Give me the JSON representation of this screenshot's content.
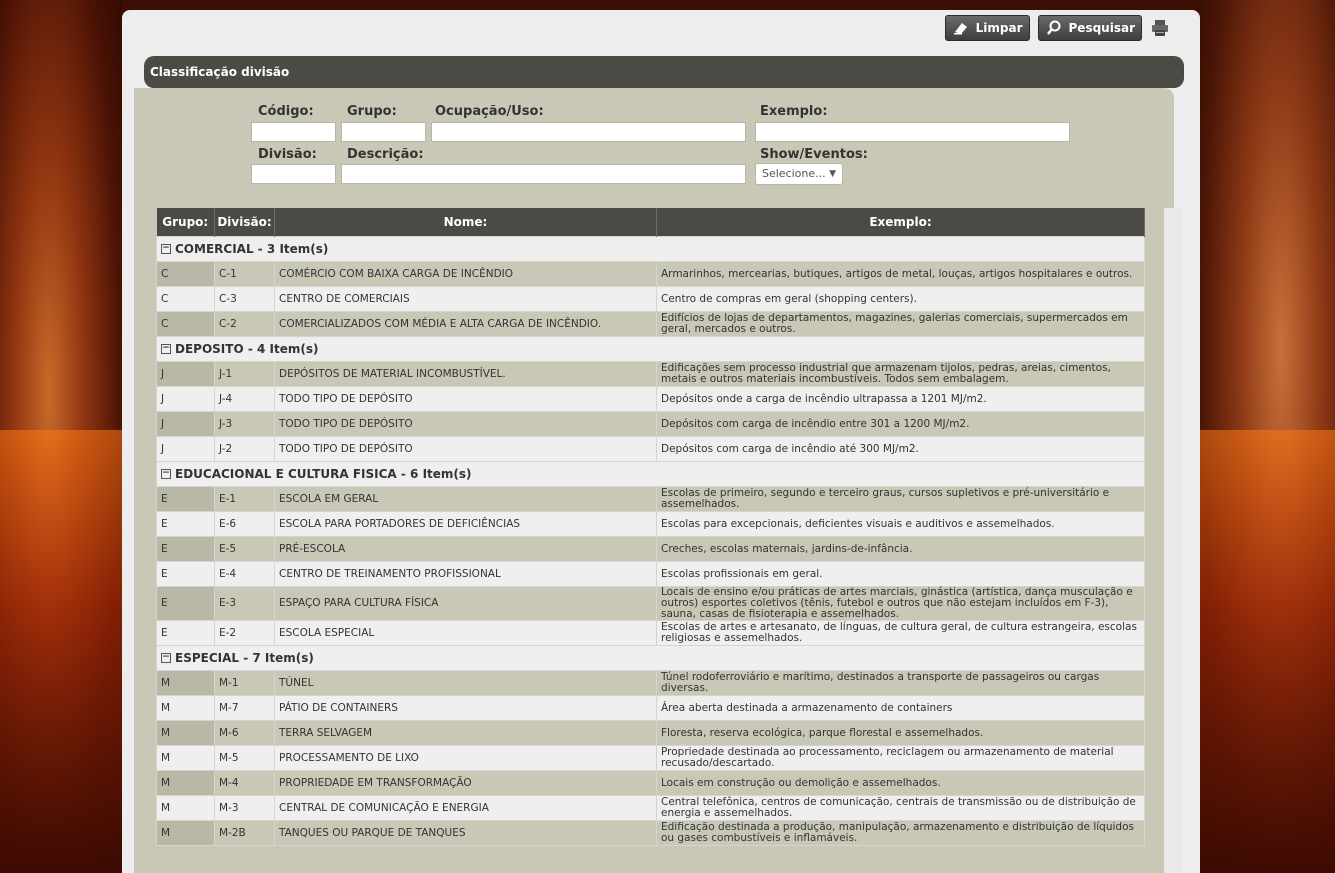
{
  "toolbar": {
    "clear_label": "Limpar",
    "search_label": "Pesquisar"
  },
  "panel": {
    "title": "Classificação divisão"
  },
  "form": {
    "codigo_label": "Código:",
    "grupo_label": "Grupo:",
    "ocupacao_label": "Ocupação/Uso:",
    "exemplo_label": "Exemplo:",
    "divisao_label": "Divisão:",
    "descricao_label": "Descrição:",
    "show_label": "Show/Eventos:",
    "show_value": "Selecione..."
  },
  "table": {
    "headers": [
      "Grupo:",
      "Divisão:",
      "Nome:",
      "Exemplo:"
    ],
    "groups": [
      {
        "title": "COMERCIAL - 3 Item(s)",
        "rows": [
          [
            "C",
            "C-1",
            "COMÉRCIO COM BAIXA CARGA DE INCÊNDIO",
            "Armarinhos, mercearias, butiques, artigos de metal, louças, artigos hospitalares e outros."
          ],
          [
            "C",
            "C-3",
            "CENTRO DE COMERCIAIS",
            "Centro de compras em geral (shopping centers)."
          ],
          [
            "C",
            "C-2",
            "COMERCIALIZADOS COM MÉDIA E ALTA CARGA DE INCÊNDIO.",
            "Edifícios de lojas de departamentos, magazines, galerias comerciais, supermercados em geral, mercados e outros."
          ]
        ]
      },
      {
        "title": "DEPOSITO - 4 Item(s)",
        "rows": [
          [
            "J",
            "J-1",
            "DEPÓSITOS DE MATERIAL INCOMBUSTÍVEL.",
            "Edificações sem processo industrial que armazenam tijolos, pedras, areias, cimentos, metais e outros materiais incombustíveis. Todos sem embalagem."
          ],
          [
            "J",
            "J-4",
            "TODO TIPO DE DEPÓSITO",
            "Depósitos onde a carga de incêndio ultrapassa a 1201 MJ/m2."
          ],
          [
            "J",
            "J-3",
            "TODO TIPO DE DEPÓSITO",
            "Depósitos com carga de incêndio entre 301 a 1200 MJ/m2."
          ],
          [
            "J",
            "J-2",
            "TODO TIPO DE DEPÓSITO",
            "Depósitos com carga de incêndio até 300 MJ/m2."
          ]
        ]
      },
      {
        "title": "EDUCACIONAL E CULTURA FISICA - 6 Item(s)",
        "rows": [
          [
            "E",
            "E-1",
            "ESCOLA EM GERAL",
            "Escolas de primeiro, segundo e terceiro graus, cursos supletivos e pré-universitário e assemelhados."
          ],
          [
            "E",
            "E-6",
            "ESCOLA PARA PORTADORES DE DEFICIÊNCIAS",
            "Escolas para excepcionais, deficientes visuais e auditivos e assemelhados."
          ],
          [
            "E",
            "E-5",
            "PRÉ-ESCOLA",
            "Creches, escolas maternais, jardins-de-infância."
          ],
          [
            "E",
            "E-4",
            "CENTRO DE TREINAMENTO PROFISSIONAL",
            "Escolas profissionais em geral."
          ],
          [
            "E",
            "E-3",
            "ESPAÇO PARA CULTURA FÍSICA",
            "Locais de ensino e/ou práticas de artes marciais, ginástica (artística, dança musculação e outros) esportes coletivos (tênis, futebol e outros que não estejam incluídos em F-3), sauna, casas de fisioterapia e assemelhados."
          ],
          [
            "E",
            "E-2",
            "ESCOLA ESPECIAL",
            "Escolas de artes e artesanato, de línguas, de cultura geral, de cultura estrangeira, escolas religiosas e assemelhados."
          ]
        ]
      },
      {
        "title": "ESPECIAL - 7 Item(s)",
        "rows": [
          [
            "M",
            "M-1",
            "TÚNEL",
            "Túnel rodoferroviário e marítimo, destinados a transporte de passageiros ou cargas diversas."
          ],
          [
            "M",
            "M-7",
            "PÁTIO DE CONTAINERS",
            "Área aberta destinada a armazenamento de containers"
          ],
          [
            "M",
            "M-6",
            "TERRA SELVAGEM",
            "Floresta, reserva ecológica, parque florestal e assemelhados."
          ],
          [
            "M",
            "M-5",
            "PROCESSAMENTO DE LIXO",
            "Propriedade destinada ao processamento, reciclagem ou armazenamento de material recusado/descartado."
          ],
          [
            "M",
            "M-4",
            "PROPRIEDADE EM TRANSFORMAÇÃO",
            "Locais em construção ou demolição e assemelhados."
          ],
          [
            "M",
            "M-3",
            "CENTRAL DE COMUNICAÇÃO E ENERGIA",
            "Central telefônica, centros de comunicação, centrais de transmissão ou de distribuição de energia e assemelhados."
          ],
          [
            "M",
            "M-2B",
            "TANQUES OU PARQUE DE TANQUES",
            "Edificação destinada a produção, manipulação, armazenamento e distribuição de líquidos ou gases combustíveis e inflamáveis."
          ]
        ]
      }
    ]
  }
}
